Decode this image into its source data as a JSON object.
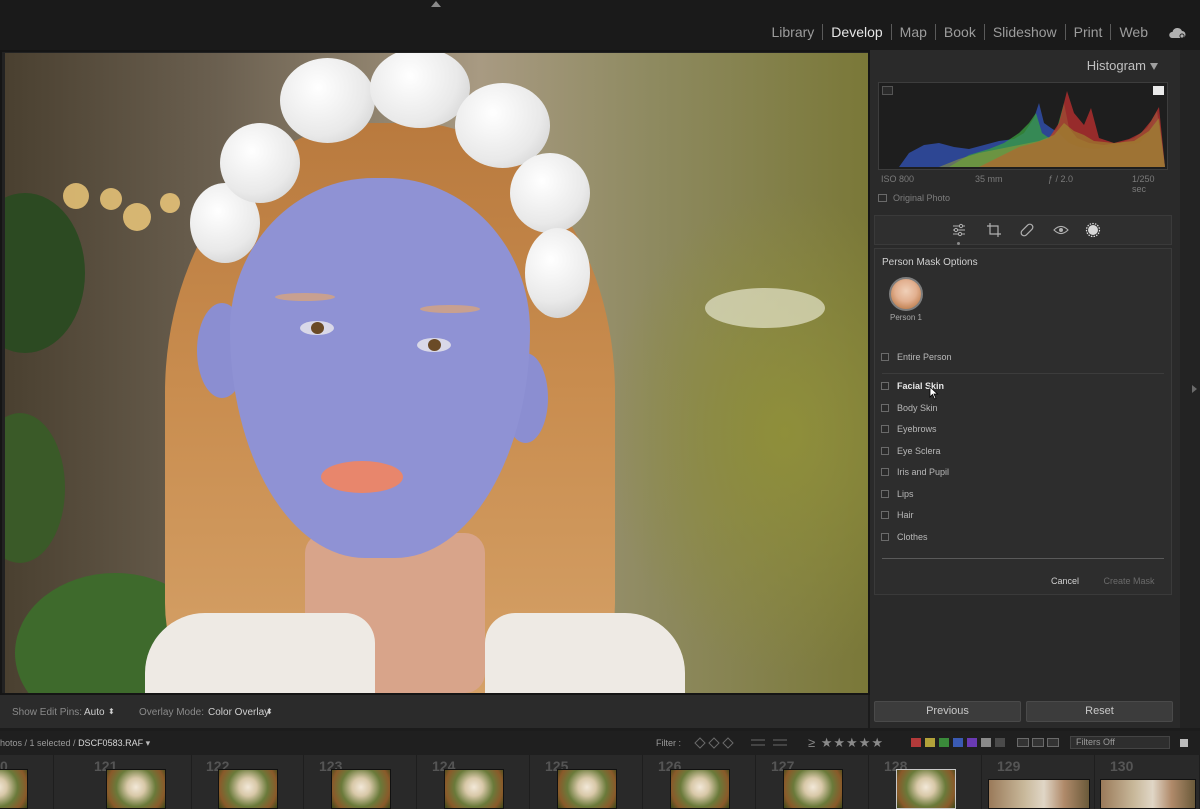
{
  "modules": [
    "Library",
    "Develop",
    "Map",
    "Book",
    "Slideshow",
    "Print",
    "Web"
  ],
  "active_module": "Develop",
  "histogram": {
    "title": "Histogram",
    "iso": "ISO 800",
    "focal_length": "35 mm",
    "aperture": "ƒ / 2.0",
    "shutter": "1/250 sec",
    "original_photo": "Original Photo"
  },
  "mask_options": {
    "title": "Person Mask Options",
    "person_label": "Person 1",
    "entire_person": "Entire Person",
    "items": [
      "Facial Skin",
      "Body Skin",
      "Eyebrows",
      "Eye Sclera",
      "Iris and Pupil",
      "Lips",
      "Hair",
      "Clothes"
    ],
    "cancel": "Cancel",
    "create": "Create Mask"
  },
  "toolbar": {
    "edit_pins_label": "Show Edit Pins:",
    "edit_pins_value": "Auto",
    "overlay_label": "Overlay Mode:",
    "overlay_value": "Color Overlay"
  },
  "panel_buttons": {
    "previous": "Previous",
    "reset": "Reset"
  },
  "filmstrip": {
    "path": "hotos / 1 selected /",
    "filename": "DSCF0583.RAF",
    "filter_label": "Filter :",
    "filter_value": "Filters Off",
    "numbers": [
      "0",
      "121",
      "122",
      "123",
      "124",
      "125",
      "126",
      "127",
      "128",
      "129",
      "130"
    ]
  },
  "colors": {
    "mask_overlay": "#8f92d4",
    "label_red": "#b33a3a",
    "label_yellow": "#b3a23a",
    "label_green": "#3a8a3a",
    "label_blue": "#3a5ab3",
    "label_purple": "#6a3ab3"
  }
}
